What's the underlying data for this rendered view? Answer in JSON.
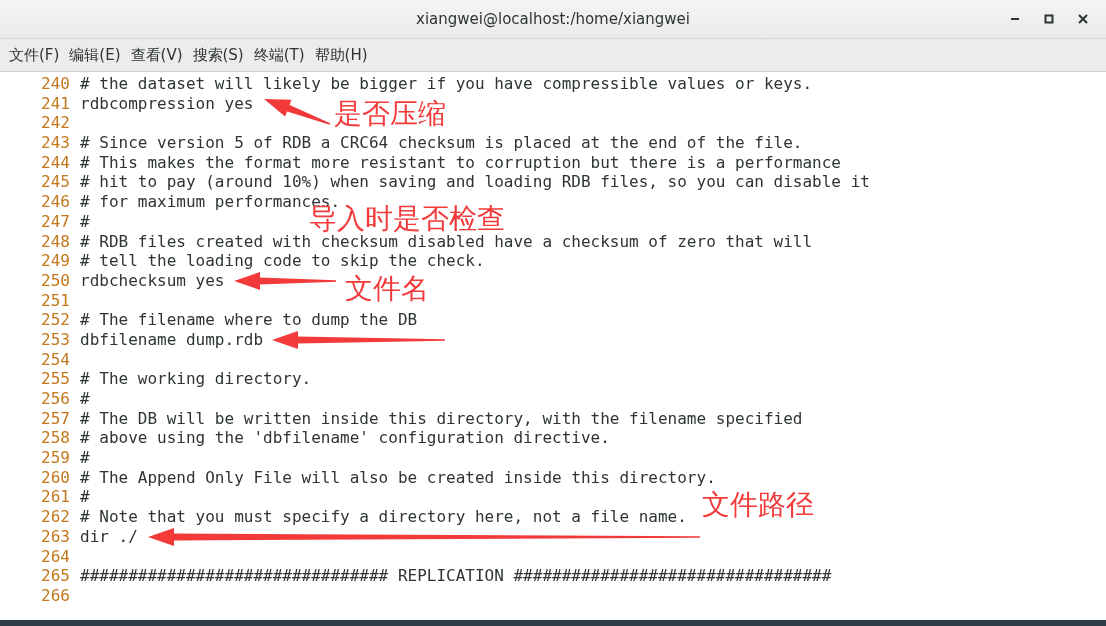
{
  "window": {
    "title": "xiangwei@localhost:/home/xiangwei"
  },
  "menu": [
    "文件(F)",
    "编辑(E)",
    "查看(V)",
    "搜索(S)",
    "终端(T)",
    "帮助(H)"
  ],
  "lines": [
    {
      "number": "240",
      "text": "# the dataset will likely be bigger if you have compressible values or keys."
    },
    {
      "number": "241",
      "text": "rdbcompression yes"
    },
    {
      "number": "242"
    },
    {
      "number": "243",
      "text": "# Since version 5 of RDB a CRC64 checksum is placed at the end of the file."
    },
    {
      "number": "244",
      "text": "# This makes the format more resistant to corruption but there is a performance"
    },
    {
      "number": "245",
      "text": "# hit to pay (around 10%) when saving and loading RDB files, so you can disable it"
    },
    {
      "number": "246",
      "text": "# for maximum performances."
    },
    {
      "number": "247",
      "text": "#"
    },
    {
      "number": "248",
      "text": "# RDB files created with checksum disabled have a checksum of zero that will"
    },
    {
      "number": "249",
      "text": "# tell the loading code to skip the check."
    },
    {
      "number": "250",
      "text": "rdbchecksum yes"
    },
    {
      "number": "251"
    },
    {
      "number": "252",
      "text": "# The filename where to dump the DB"
    },
    {
      "number": "253",
      "text": "dbfilename dump.rdb"
    },
    {
      "number": "254"
    },
    {
      "number": "255",
      "text": "# The working directory."
    },
    {
      "number": "256",
      "text": "#"
    },
    {
      "number": "257",
      "text": "# The DB will be written inside this directory, with the filename specified"
    },
    {
      "number": "258",
      "text": "# above using the 'dbfilename' configuration directive."
    },
    {
      "number": "259",
      "text": "#"
    },
    {
      "number": "260",
      "text": "# The Append Only File will also be created inside this directory."
    },
    {
      "number": "261",
      "text": "#"
    },
    {
      "number": "262",
      "text": "# Note that you must specify a directory here, not a file name."
    },
    {
      "number": "263",
      "text": "dir ./"
    },
    {
      "number": "264"
    },
    {
      "number": "265",
      "text": "################################ REPLICATION #################################"
    },
    {
      "number": "266"
    }
  ],
  "annotations": [
    "是否压缩",
    "导入时是否检查",
    "文件名",
    "文件路径"
  ]
}
